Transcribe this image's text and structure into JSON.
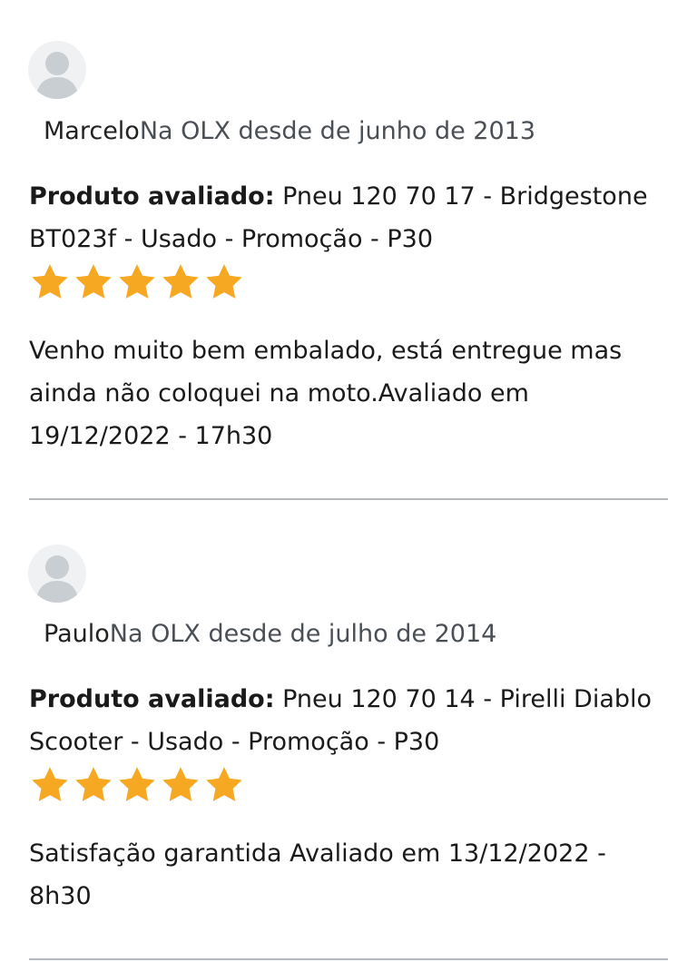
{
  "reviews": [
    {
      "user_name": "Marcelo",
      "member_since": "Na OLX desde de junho de 2013",
      "product_label": "Produto avaliado:",
      "product_name": " Pneu 120 70 17 - Bridgestone BT023f - Usado - Promoção - P30",
      "rating": 5,
      "comment": "Venho muito bem embalado, está entregue mas ainda não coloquei na moto.Avaliado em 19/12/2022 - 17h30"
    },
    {
      "user_name": "Paulo",
      "member_since": "Na OLX desde de julho de 2014",
      "product_label": "Produto avaliado:",
      "product_name": " Pneu 120 70 14 - Pirelli Diablo Scooter - Usado - Promoção - P30",
      "rating": 5,
      "comment": "Satisfação garantida Avaliado em 13/12/2022 - 8h30"
    }
  ],
  "colors": {
    "star": "#f7a823",
    "divider": "#b5b8bc",
    "avatar_bg": "#f0f1f2",
    "avatar_figure": "#c9ced3"
  },
  "icons": {
    "avatar": "user-avatar-icon",
    "star": "star-icon"
  }
}
